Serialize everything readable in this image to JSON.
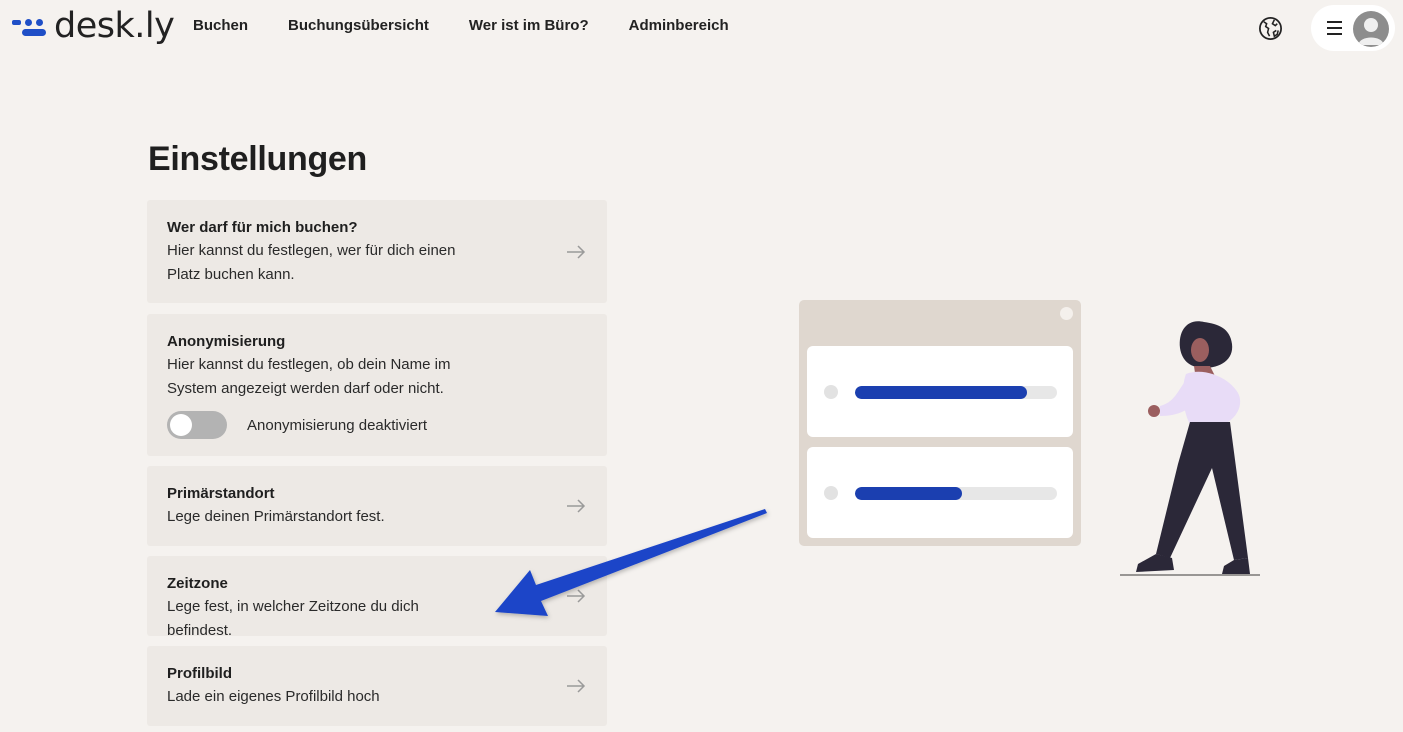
{
  "brand": {
    "name": "desk.ly",
    "accent": "#1f4fc7"
  },
  "nav": {
    "items": [
      "Buchen",
      "Buchungsübersicht",
      "Wer ist im Büro?",
      "Adminbereich"
    ]
  },
  "header_icons": {
    "language": "globe-icon",
    "menu": "hamburger-icon",
    "avatar": "user-avatar-icon"
  },
  "page": {
    "title": "Einstellungen"
  },
  "cards": [
    {
      "title": "Wer darf für mich buchen?",
      "description": "Hier kannst du festlegen, wer für dich einen Platz buchen kann."
    },
    {
      "title": "Anonymisierung",
      "description": "Hier kannst du festlegen, ob dein Name im System angezeigt werden darf oder nicht.",
      "toggle_label": "Anonymisierung deaktiviert",
      "toggle_on": false
    },
    {
      "title": "Primärstandort",
      "description": "Lege deinen Primärstandort fest."
    },
    {
      "title": "Zeitzone",
      "description": "Lege fest, in welcher Zeitzone du dich befindest."
    },
    {
      "title": "Profilbild",
      "description": "Lade ein eigenes Profilbild hoch"
    }
  ],
  "illustration": {
    "progress": [
      0.85,
      0.53
    ],
    "bar_color": "#1b3fb0"
  },
  "annotation": {
    "arrow_color": "#1a45c8"
  }
}
